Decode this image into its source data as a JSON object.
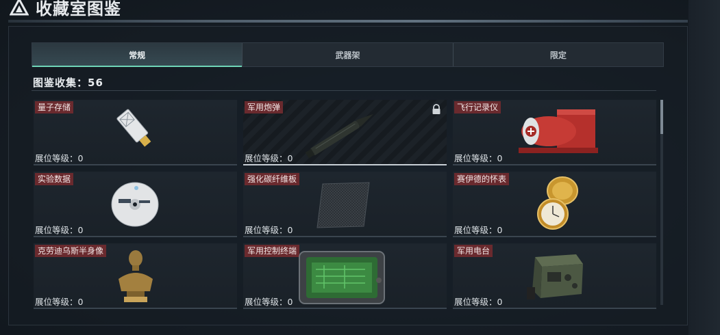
{
  "window": {
    "title": "收藏室图鉴",
    "icon": "warning-triangle-icon"
  },
  "tabs": [
    {
      "label": "常规",
      "active": true
    },
    {
      "label": "武器架",
      "active": false
    },
    {
      "label": "限定",
      "active": false
    }
  ],
  "collection": {
    "count_label": "图鉴收集：56"
  },
  "items": [
    {
      "name": "量子存储",
      "level": "展位等级：0",
      "locked": false,
      "icon": "usb-drive-icon"
    },
    {
      "name": "军用炮弹",
      "level": "展位等级：0",
      "locked": true,
      "icon": "artillery-shell-icon"
    },
    {
      "name": "飞行记录仪",
      "level": "展位等级：0",
      "locked": false,
      "icon": "flight-recorder-icon"
    },
    {
      "name": "实验数据",
      "level": "展位等级：0",
      "locked": false,
      "icon": "data-disc-icon"
    },
    {
      "name": "强化碳纤维板",
      "level": "展位等级：0",
      "locked": false,
      "icon": "carbon-plate-icon"
    },
    {
      "name": "赛伊德的怀表",
      "level": "展位等级：0",
      "locked": false,
      "icon": "pocket-watch-icon"
    },
    {
      "name": "克劳迪乌斯半身像",
      "level": "展位等级：0",
      "locked": false,
      "icon": "bust-statue-icon"
    },
    {
      "name": "军用控制终端",
      "level": "展位等级：0",
      "locked": false,
      "icon": "control-terminal-icon"
    },
    {
      "name": "军用电台",
      "level": "展位等级：0",
      "locked": false,
      "icon": "military-radio-icon"
    }
  ],
  "colors": {
    "accent": "#6fd6b8",
    "label_bg": "#6a2a2e",
    "background": "#151b22"
  }
}
